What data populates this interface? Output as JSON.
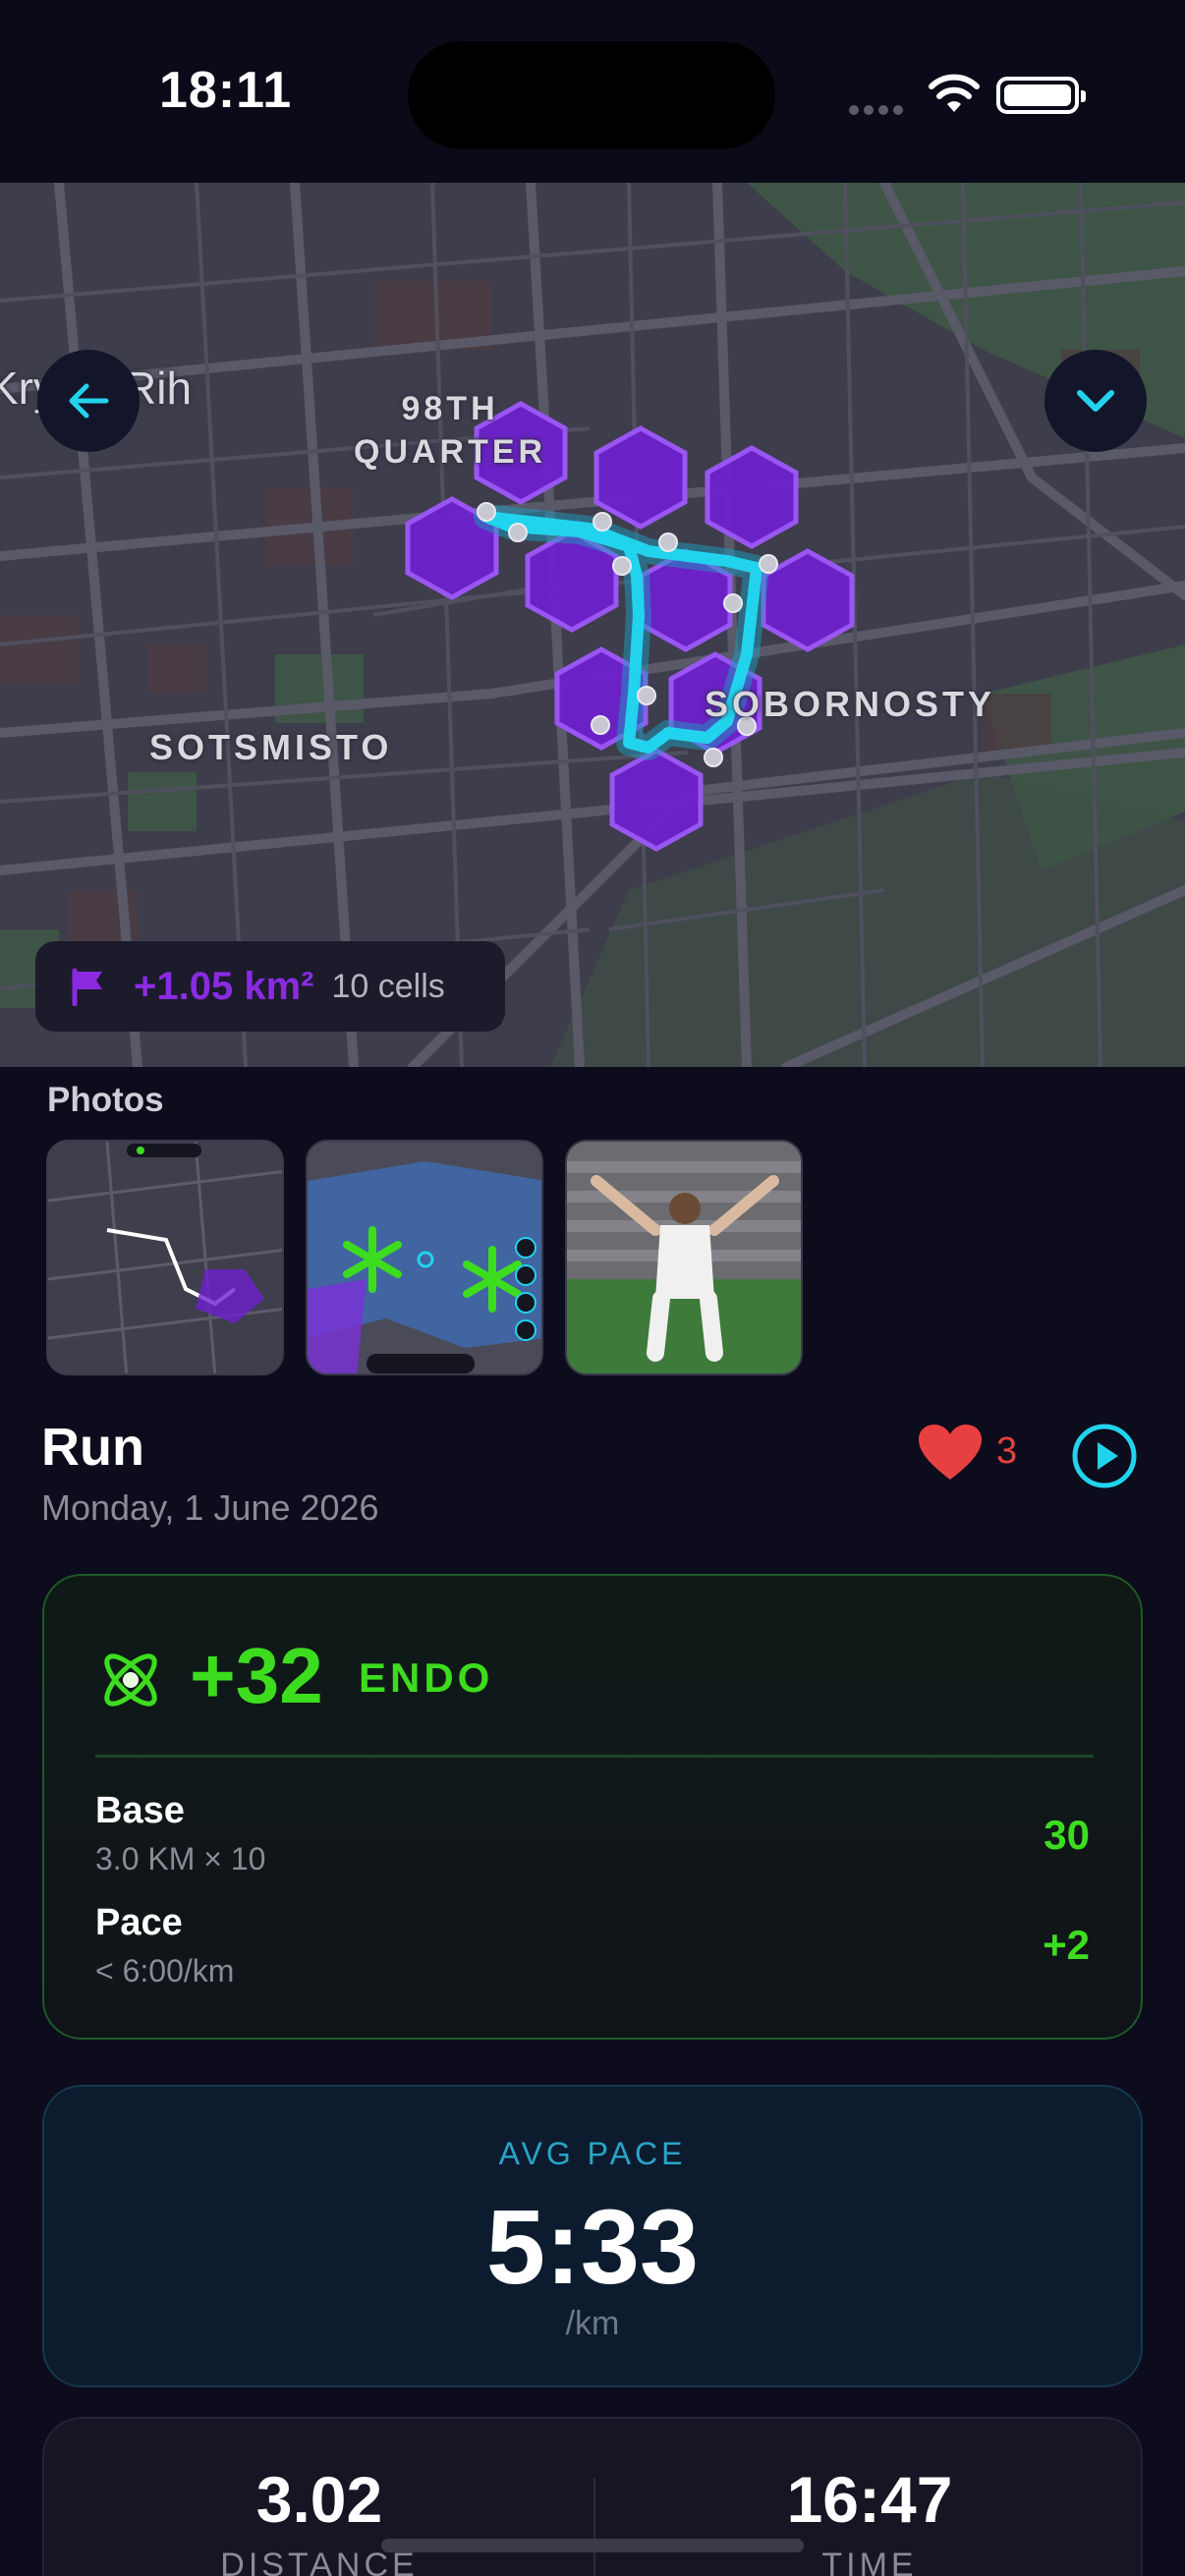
{
  "status_bar": {
    "time": "18:11"
  },
  "map": {
    "labels": {
      "city": "Kryvyi Rih",
      "quarter_line1": "98TH",
      "quarter_line2": "QUARTER",
      "district_west": "SOTSMISTO",
      "district_east": "SOBORNOSTY"
    },
    "territory": {
      "area": "+1.05 km²",
      "cells": "10 cells"
    },
    "colors": {
      "hex_fill": "#7a2fd8",
      "route": "#22d3ee"
    }
  },
  "photos": {
    "title": "Photos"
  },
  "activity": {
    "type": "Run",
    "date": "Monday, 1 June 2026",
    "likes": "3"
  },
  "endo": {
    "value": "+32",
    "unit": "ENDO",
    "rows": [
      {
        "label": "Base",
        "detail": "3.0 KM × 10",
        "value": "30"
      },
      {
        "label": "Pace",
        "detail": "< 6:00/km",
        "value": "+2"
      }
    ]
  },
  "avg_pace": {
    "label": "AVG PACE",
    "value": "5:33",
    "unit": "/km"
  },
  "stats": {
    "distance_value": "3.02",
    "distance_label": "DISTANCE",
    "time_value": "16:47",
    "time_label": "TIME"
  },
  "colors": {
    "accent_green": "#3ddc1f",
    "accent_cyan": "#22d3ee",
    "heart_red": "#e84040",
    "territory_purple": "#8a2be2"
  }
}
